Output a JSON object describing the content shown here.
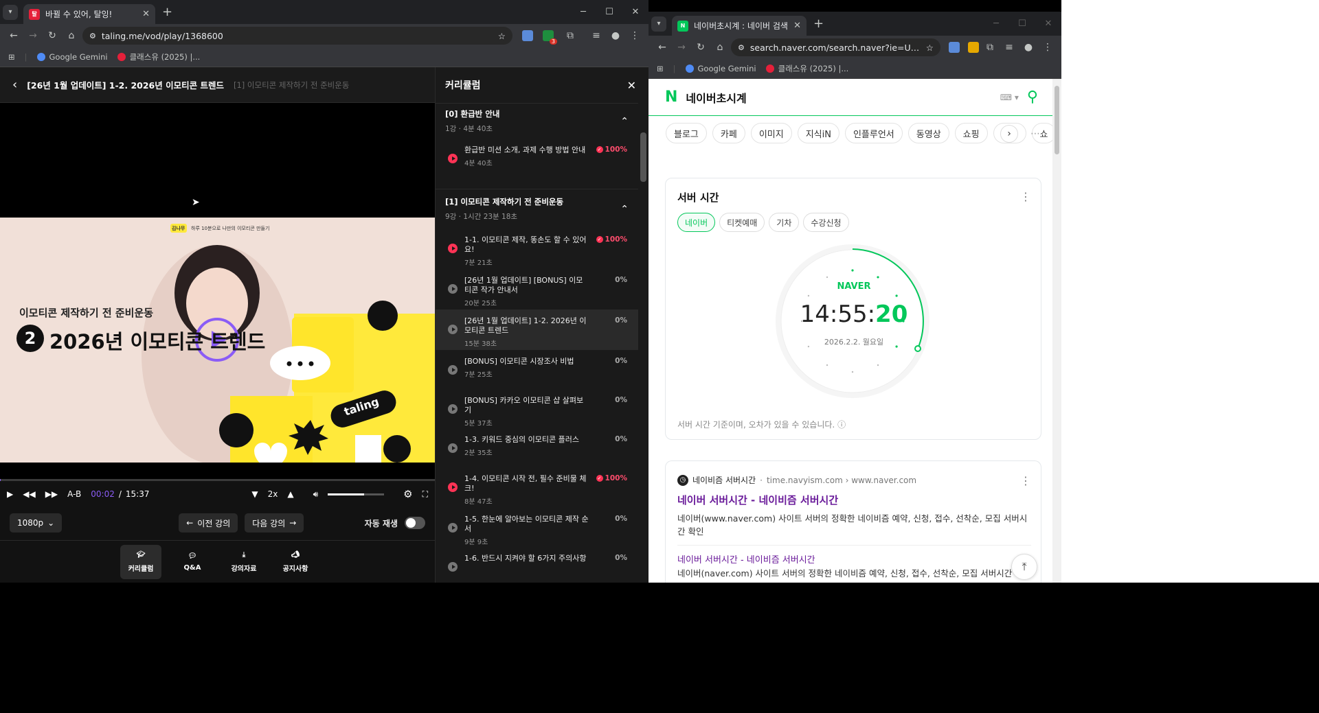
{
  "win1": {
    "tab_title": "바뀔 수 있어, 탈잉!",
    "favicon_text": "탈",
    "url": "taling.me/vod/play/1368600",
    "ext_badge": "3",
    "bookmarks": [
      "Google Gemini",
      "클래스유 (2025) |..."
    ]
  },
  "player": {
    "title": "[26년 1월 업데이트] 1-2. 2026년 이모티콘 트렌드",
    "subtitle": "[1] 이모티콘 제작하기 전 준비운동",
    "thumb_tag_name": "김나무",
    "thumb_tag_text": "하루 10분으로 나만의 이모티콘 만들기",
    "thumb_line1": "이모티콘 제작하기 전 준비운동",
    "thumb_num": "2",
    "thumb_line2": "2026년 이모티콘 트렌드",
    "thumb_brand": "taling",
    "progress": 0.002,
    "ab_label": "A-B",
    "time_current": "00:02",
    "time_sep": "/",
    "time_total": "15:37",
    "speed": "2x",
    "volume": 0.65,
    "quality": "1080p",
    "prev_label": "이전 강의",
    "next_label": "다음 강의",
    "autoplay_label": "자동 재생",
    "nav": [
      "커리큘럼",
      "Q&A",
      "강의자료",
      "공지사항"
    ]
  },
  "curriculum": {
    "title": "커리큘럼",
    "sections": [
      {
        "name": "[0] 환급반 안내",
        "meta": "1강 · 4분 40초",
        "lessons": [
          {
            "title": "환급반 미션 소개, 과제 수행 방법 안내",
            "dur": "4분 40초",
            "pct": "100%"
          }
        ]
      },
      {
        "name": "[1] 이모티콘 제작하기 전 준비운동",
        "meta": "9강 · 1시간 23분 18초",
        "lessons": [
          {
            "title": "1-1. 이모티콘 제작, 똥손도 할 수 있어요!",
            "dur": "7분 21초",
            "pct": "100%"
          },
          {
            "title": "[26년 1월 업데이트] [BONUS] 이모티콘 작가 안내서",
            "dur": "20분 25초",
            "pct": "0%"
          },
          {
            "title": "[26년 1월 업데이트] 1-2. 2026년 이모티콘 트렌드",
            "dur": "15분 38초",
            "pct": "0%"
          },
          {
            "title": "[BONUS] 이모티콘 시장조사 비법",
            "dur": "7분 25초",
            "pct": "0%"
          },
          {
            "title": "[BONUS] 카카오 이모티콘 샵 살펴보기",
            "dur": "5분 37초",
            "pct": "0%"
          },
          {
            "title": "1-3. 키워드 중심의 이모티콘 플러스",
            "dur": "2분 35초",
            "pct": "0%"
          },
          {
            "title": "1-4. 이모티콘 시작 전, 필수 준비물 체크!",
            "dur": "8분 47초",
            "pct": "100%"
          },
          {
            "title": "1-5. 한눈에 알아보는 이모티콘 제작 순서",
            "dur": "9분 9초",
            "pct": "0%"
          },
          {
            "title": "1-6. 반드시 지켜야 할 6가지 주의사항",
            "dur": "",
            "pct": "0%"
          }
        ]
      }
    ]
  },
  "win2": {
    "tab_title": "네이버초시계 : 네이버 검색",
    "favicon_text": "N",
    "url": "search.naver.com/search.naver?ie=UT...",
    "bookmarks": [
      "Google Gemini",
      "클래스유 (2025) |..."
    ]
  },
  "naver": {
    "logo": "N",
    "query": "네이버초시계",
    "chips": [
      "블로그",
      "카페",
      "이미지",
      "지식iN",
      "인플루언서",
      "동영상",
      "쇼핑",
      "뉴스",
      "쇼"
    ],
    "card_title": "서버 시간",
    "server_chips": [
      "네이버",
      "티켓예매",
      "기차",
      "수강신청"
    ],
    "clock_brand": "NAVER",
    "time_hm": "14:55:",
    "time_s": "20",
    "date": "2026.2.2. 월요일",
    "note": "서버 시간 기준이며, 오차가 있을 수 있습니다.",
    "result_site": "네이비즘 서버시간",
    "result_url": "time.navyism.com › www.naver.com",
    "result_title": "네이버 서버시간 - 네이비즘 서버시간",
    "result_desc": "네이버(www.naver.com) 사이트 서버의 정확한 네이비즘 예약, 신청, 접수, 선착순, 모집 서버시간 확인",
    "sub_title": "네이버 서버시간 - 네이비즘 서버시간",
    "sub_desc": "네이버(naver.com) 사이트 서버의 정확한 네이비즘 예약, 신청, 접수, 선착순, 모집 서버시간"
  },
  "colors": {
    "accent_purple": "#8b5cf6",
    "naver_green": "#03c75a",
    "done_red": "#ff3355"
  }
}
